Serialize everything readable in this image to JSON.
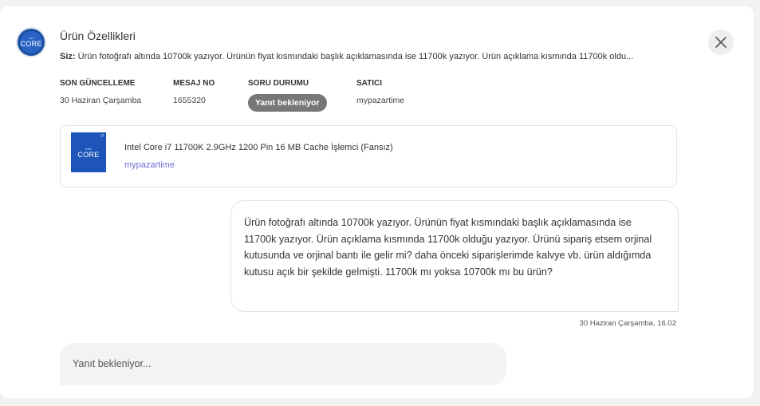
{
  "header": {
    "title": "Ürün Özellikleri",
    "avatar_text": "CORE",
    "avatar_small_text": "intel"
  },
  "summary": {
    "prefix": "Siz:",
    "text": "Ürün fotoğrafı altında 10700k yazıyor. Ürünün fiyat kısmındaki başlık açıklamasında ise 11700k yazıyor. Ürün açıklama kısmında 11700k oldu..."
  },
  "meta": {
    "last_update_label": "SON GÜNCELLEME",
    "last_update_value": "30 Haziran Çarşamba",
    "message_no_label": "MESAJ NO",
    "message_no_value": "1655320",
    "status_label": "SORU DURUMU",
    "status_value": "Yanıt bekleniyor",
    "seller_label": "SATICI",
    "seller_value": "mypazartime"
  },
  "product": {
    "name": "Intel Core i7 11700K 2.9GHz 1200 Pin 16 MB Cache İşlemci (Fansız)",
    "seller": "mypazartime",
    "thumb_core": "CORE",
    "thumb_brand": "intel",
    "thumb_tier": "i7"
  },
  "message": {
    "text": "Ürün fotoğrafı altında 10700k yazıyor. Ürünün fiyat kısmındaki başlık açıklamasında ise 11700k yazıyor. Ürün açıklama kısmında 11700k olduğu yazıyor. Ürünü sipariş etsem orjinal kutusunda ve orjinal bantı ile gelir mi? daha önceki siparişlerimde kalvye vb. ürün aldığımda kutusu açık bir şekilde gelmişti. 11700k mı yoksa 10700k mı bu ürün?",
    "timestamp": "30 Haziran Çarşamba, 16.02"
  },
  "reply": {
    "placeholder": "Yanıt bekleniyor..."
  },
  "icons": {
    "close": "close-icon"
  },
  "colors": {
    "badge_bg": "#777777",
    "link": "#6f6cd6",
    "avatar_bg": "#1b4fa0"
  }
}
